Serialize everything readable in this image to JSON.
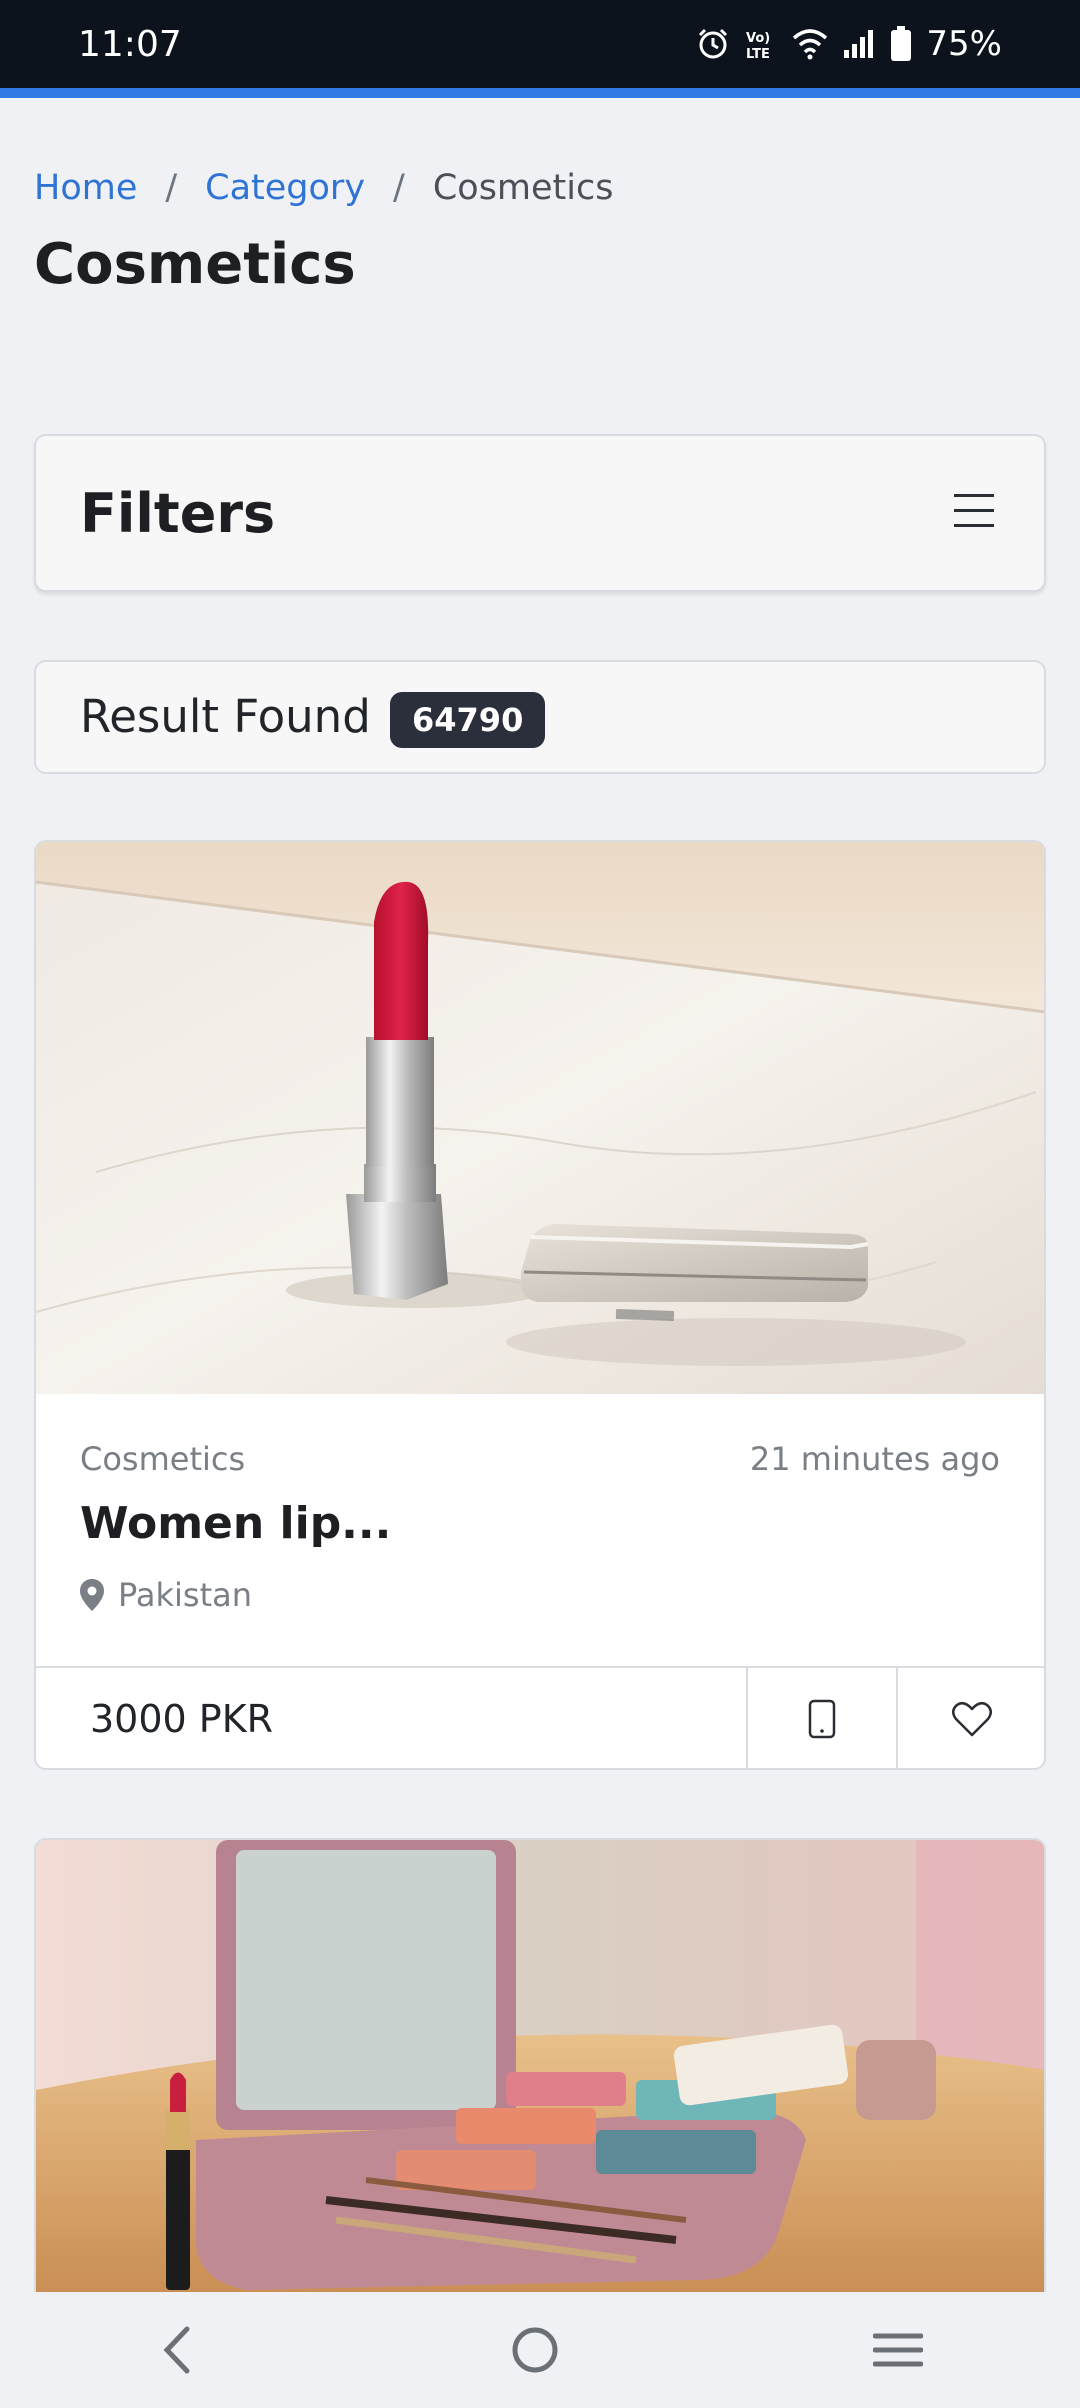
{
  "status_bar": {
    "time": "11:07",
    "battery": "75%",
    "icons": [
      "alarm-icon",
      "volte-icon",
      "wifi-icon",
      "signal-icon",
      "battery-icon"
    ]
  },
  "breadcrumb": {
    "home": "Home",
    "separator": "/",
    "category": "Category",
    "current": "Cosmetics"
  },
  "page_title": "Cosmetics",
  "filters": {
    "title": "Filters",
    "menu_icon": "hamburger-icon"
  },
  "results": {
    "label": "Result Found",
    "count": "64790"
  },
  "listings": [
    {
      "category": "Cosmetics",
      "time": "21 minutes ago",
      "title": "Women lip...",
      "location": "Pakistan",
      "price": "3000 PKR",
      "image": "lipstick-and-compact-photo"
    },
    {
      "image": "makeup-palette-photo"
    }
  ],
  "nav_bar": {
    "icons": [
      "back-icon",
      "home-icon",
      "recents-icon"
    ]
  },
  "colors": {
    "accent": "#2f7ae5",
    "link": "#2f74d4",
    "badge": "#2b2e3b",
    "status_bar": "#0d131c"
  }
}
